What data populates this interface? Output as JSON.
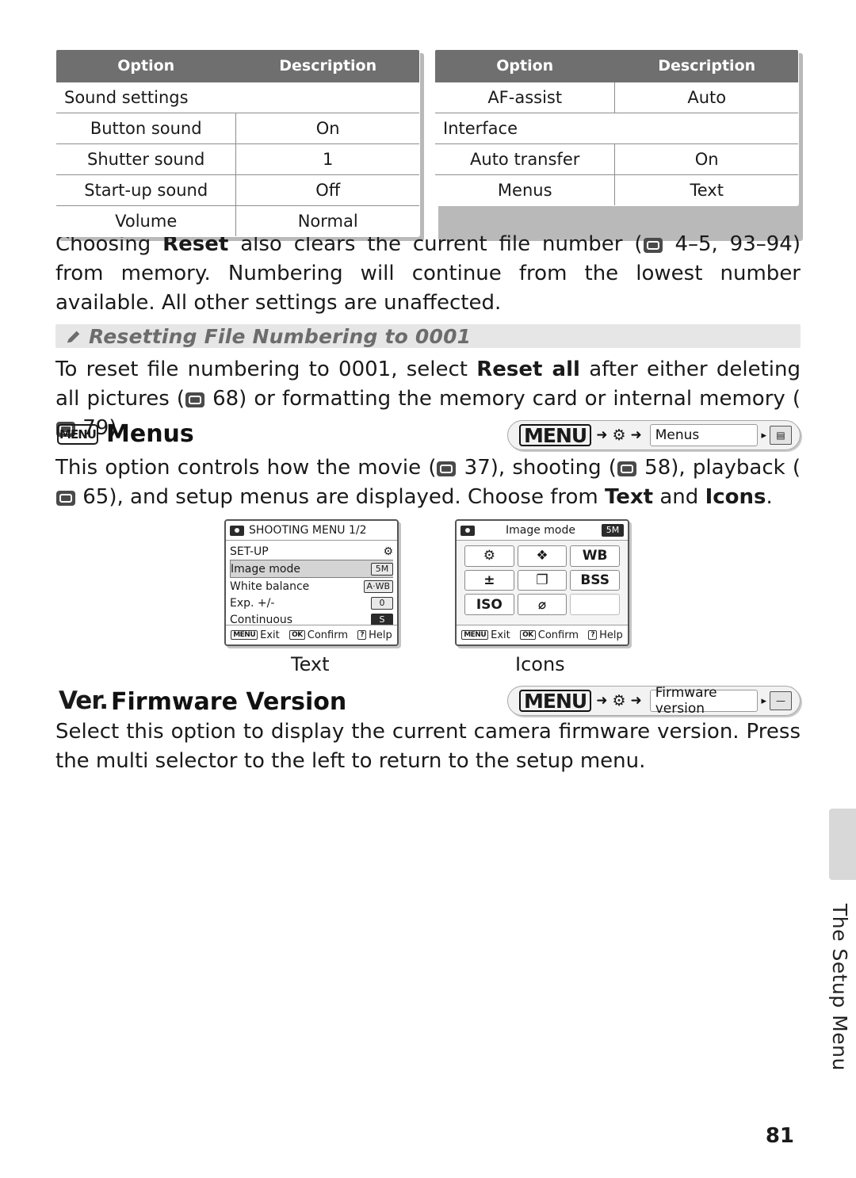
{
  "tables": [
    {
      "headers": [
        "Option",
        "Description"
      ],
      "rows": [
        {
          "type": "group",
          "option": "Sound settings",
          "description": ""
        },
        {
          "type": "item",
          "option": "Button sound",
          "description": "On"
        },
        {
          "type": "item",
          "option": "Shutter sound",
          "description": "1"
        },
        {
          "type": "item",
          "option": "Start-up sound",
          "description": "Off"
        },
        {
          "type": "item",
          "option": "Volume",
          "description": "Normal"
        }
      ]
    },
    {
      "headers": [
        "Option",
        "Description"
      ],
      "rows": [
        {
          "type": "item",
          "option": "AF-assist",
          "description": "Auto"
        },
        {
          "type": "group",
          "option": "Interface",
          "description": ""
        },
        {
          "type": "item",
          "option": "Auto transfer",
          "description": "On"
        },
        {
          "type": "item",
          "option": "Menus",
          "description": "Text"
        }
      ]
    }
  ],
  "paragraphs": {
    "reset_note_1": "Choosing ",
    "reset_bold": "Reset",
    "reset_note_2": " also clears the current file number (",
    "reset_ref": "4–5, 93–94",
    "reset_note_3": ") from memory.  Numbering will continue from the lowest number available.  All other settings are unaffected.",
    "note_title": "Resetting File Numbering to 0001",
    "note_body_1": "To reset file numbering to 0001, select ",
    "note_bold": "Reset all",
    "note_body_2": " after either deleting all pictures (",
    "note_ref_1": "68",
    "note_body_3": ") or formatting the memory card or internal memory (",
    "note_ref_2": "79",
    "note_body_4": ").",
    "menus_body_1": "This option controls how the movie (",
    "menus_ref_1": "37",
    "menus_body_2": "), shooting (",
    "menus_ref_2": "58",
    "menus_body_3": "), playback (",
    "menus_ref_3": "65",
    "menus_body_4": "), and setup menus are displayed.  Choose from ",
    "menus_bold_1": "Text",
    "menus_body_5": " and ",
    "menus_bold_2": "Icons",
    "menus_body_6": ".",
    "firmware_body": "Select this option to display the current camera firmware version.  Press the multi selector to the left to return to the setup menu."
  },
  "sections": {
    "menus": {
      "badge": "MENU",
      "title": "Menus"
    },
    "firmware": {
      "badge": "Ver.",
      "title": "Firmware Version"
    }
  },
  "breadcrumbs": {
    "menus": {
      "menu_word": "MENU",
      "arrow": "➜",
      "wrench": "⚙",
      "field": "Menus",
      "tri": "▸",
      "end": "▤"
    },
    "firmware": {
      "menu_word": "MENU",
      "arrow": "➜",
      "wrench": "⚙",
      "field": "Firmware version",
      "tri": "▸",
      "end": "—"
    }
  },
  "lcd_text_menu": {
    "title": "SHOOTING MENU 1/2",
    "rows": [
      {
        "label": "SET-UP",
        "value": "",
        "value_kind": "wrench",
        "selected": false
      },
      {
        "label": "Image mode",
        "value": "5M",
        "value_kind": "box",
        "selected": true
      },
      {
        "label": "White balance",
        "value": "A·WB",
        "value_kind": "box",
        "selected": false
      },
      {
        "label": "Exp. +/-",
        "value": "0",
        "value_kind": "box",
        "selected": false
      },
      {
        "label": "Continuous",
        "value": "S",
        "value_kind": "boxdark",
        "selected": false
      }
    ],
    "footer": [
      {
        "chip": "MENU",
        "label": "Exit"
      },
      {
        "chip": "OK",
        "label": "Confirm"
      },
      {
        "chip": "?",
        "label": "Help"
      }
    ],
    "caption": "Text"
  },
  "lcd_icon_menu": {
    "title": "Image mode",
    "title_badge": "5M",
    "icons": [
      {
        "name": "wrench-icon",
        "glyph": "⚙"
      },
      {
        "name": "image-mode-icon",
        "glyph": "❖"
      },
      {
        "name": "white-balance-icon",
        "glyph": "WB"
      },
      {
        "name": "exposure-icon",
        "glyph": "±"
      },
      {
        "name": "continuous-icon",
        "glyph": "❐"
      },
      {
        "name": "bss-icon",
        "glyph": "BSS"
      },
      {
        "name": "iso-icon",
        "glyph": "ISO"
      },
      {
        "name": "no-image-icon",
        "glyph": "⌀"
      },
      {
        "name": "blank-icon",
        "glyph": ""
      }
    ],
    "footer": [
      {
        "chip": "MENU",
        "label": "Exit"
      },
      {
        "chip": "OK",
        "label": "Confirm"
      },
      {
        "chip": "?",
        "label": "Help"
      }
    ],
    "caption": "Icons"
  },
  "side_tab_label": "The Setup Menu",
  "page_number": "81"
}
